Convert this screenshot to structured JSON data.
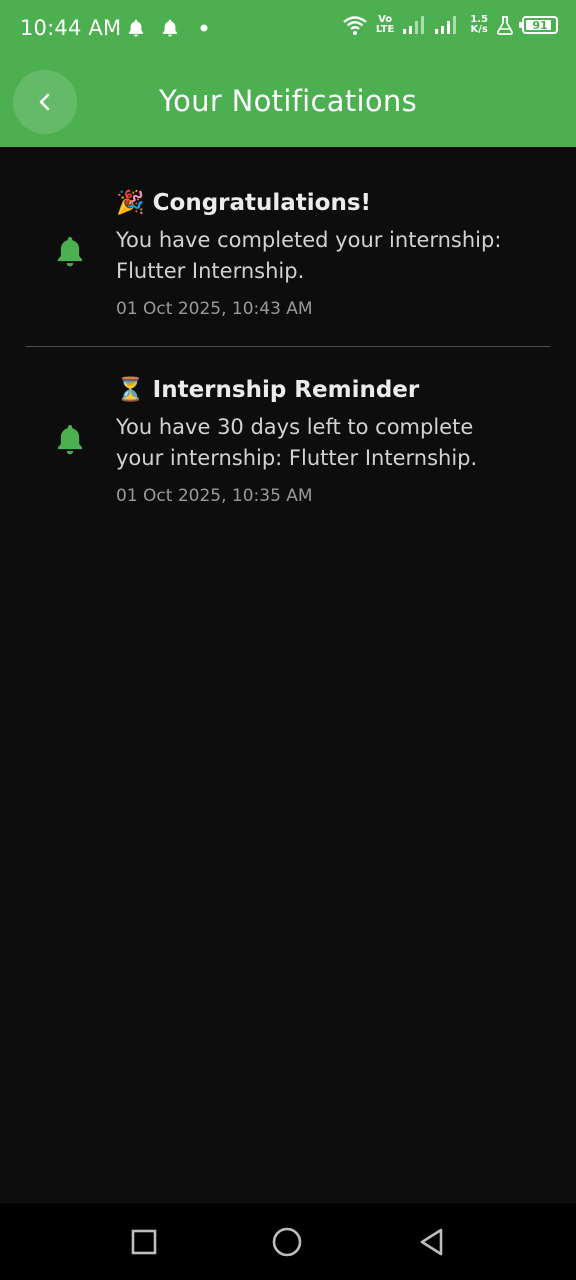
{
  "status_bar": {
    "time": "10:44 AM",
    "network_top": "Vo",
    "network_bottom": "LTE",
    "speed_top": "1.5",
    "speed_bottom": "K/s",
    "battery_level": "91",
    "battery_fraction": 0.91,
    "icons": [
      "bell-icon",
      "bell-icon",
      "dot-icon",
      "wifi-icon",
      "signal-icon",
      "signal-icon",
      "flask-icon",
      "battery-icon"
    ]
  },
  "app_bar": {
    "title": "Your Notifications",
    "back_icon": "chevron-left-icon",
    "color": "#4caf50"
  },
  "notifications": [
    {
      "emoji": "🎉",
      "title": "Congratulations!",
      "body": "You have completed your internship: Flutter Internship.",
      "timestamp": "01 Oct 2025, 10:43 AM",
      "icon": "bell-icon"
    },
    {
      "emoji": "⏳",
      "title": "Internship Reminder",
      "body": "You have 30 days left to complete your internship: Flutter Internship.",
      "timestamp": "01 Oct 2025, 10:35 AM",
      "icon": "bell-icon"
    }
  ],
  "nav_bar": {
    "icons": [
      "recents-square-icon",
      "home-circle-icon",
      "back-triangle-icon"
    ]
  },
  "colors": {
    "accent": "#4caf50",
    "background": "#0d0d0d",
    "bell": "#4caf50"
  }
}
